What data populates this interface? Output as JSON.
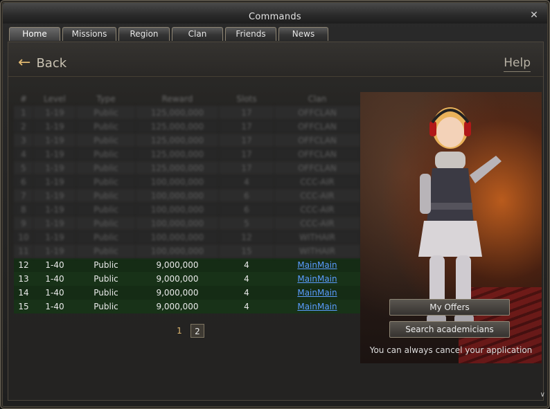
{
  "window": {
    "title": "Commands",
    "close_label": "✕"
  },
  "tabs": [
    {
      "label": "Home",
      "active": true
    },
    {
      "label": "Missions"
    },
    {
      "label": "Region"
    },
    {
      "label": "Clan"
    },
    {
      "label": "Friends"
    },
    {
      "label": "News"
    }
  ],
  "header": {
    "back_label": "Back",
    "help_label": "Help"
  },
  "table": {
    "columns": [
      "#",
      "Level",
      "Type",
      "Reward",
      "Slots",
      "Clan"
    ],
    "blurred_rows": [
      [
        "1",
        "1-19",
        "Public",
        "125,000,000",
        "17",
        "OFFCLAN"
      ],
      [
        "2",
        "1-19",
        "Public",
        "125,000,000",
        "17",
        "OFFCLAN"
      ],
      [
        "3",
        "1-19",
        "Public",
        "125,000,000",
        "17",
        "OFFCLAN"
      ],
      [
        "4",
        "1-19",
        "Public",
        "125,000,000",
        "17",
        "OFFCLAN"
      ],
      [
        "5",
        "1-19",
        "Public",
        "125,000,000",
        "17",
        "OFFCLAN"
      ],
      [
        "6",
        "1-19",
        "Public",
        "100,000,000",
        "4",
        "CCC-AIR"
      ],
      [
        "7",
        "1-19",
        "Public",
        "100,000,000",
        "6",
        "CCC-AIR"
      ],
      [
        "8",
        "1-19",
        "Public",
        "100,000,000",
        "6",
        "CCC-AIR"
      ],
      [
        "9",
        "1-19",
        "Public",
        "100,000,000",
        "5",
        "CCC-AIR"
      ],
      [
        "10",
        "1-19",
        "Public",
        "100,000,000",
        "12",
        "WITHAIR"
      ],
      [
        "11",
        "1-19",
        "Public",
        "100,000,000",
        "15",
        "WITHAIR"
      ]
    ],
    "rows": [
      {
        "num": "12",
        "level": "1-40",
        "type": "Public",
        "reward": "9,000,000",
        "slots": "4",
        "clan": "MainMain"
      },
      {
        "num": "13",
        "level": "1-40",
        "type": "Public",
        "reward": "9,000,000",
        "slots": "4",
        "clan": "MainMain"
      },
      {
        "num": "14",
        "level": "1-40",
        "type": "Public",
        "reward": "9,000,000",
        "slots": "4",
        "clan": "MainMain"
      },
      {
        "num": "15",
        "level": "1-40",
        "type": "Public",
        "reward": "9,000,000",
        "slots": "4",
        "clan": "MainMain"
      }
    ]
  },
  "pagination": {
    "pages": [
      "1",
      "2"
    ],
    "current": "1"
  },
  "side_panel": {
    "my_offers_label": "My Offers",
    "search_label": "Search academicians",
    "note": "You can always cancel your application"
  },
  "icons": {
    "back": "back-arrow-icon",
    "close": "close-icon",
    "scroll": "chevron-down-icon"
  },
  "colors": {
    "accent": "#e0b870",
    "link": "#5a9cff",
    "row_highlight": "#183218"
  }
}
